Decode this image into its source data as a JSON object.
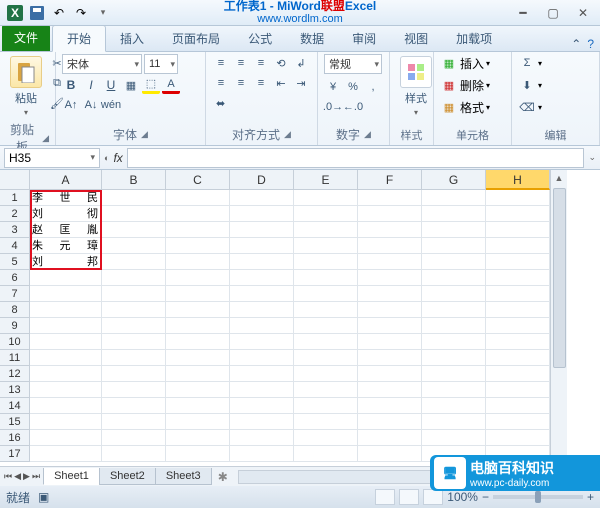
{
  "title": {
    "pre": "工作表1 - Mi",
    "brand_a": "Word",
    "brand_b": "联盟",
    "post": "Excel",
    "url": "www.wordlm.com"
  },
  "tabs": {
    "file": "文件",
    "home": "开始",
    "insert": "插入",
    "layout": "页面布局",
    "formulas": "公式",
    "data": "数据",
    "review": "审阅",
    "view": "视图",
    "addins": "加载项"
  },
  "ribbon": {
    "clipboard": {
      "label": "剪贴板",
      "paste": "粘贴"
    },
    "font": {
      "label": "字体",
      "name": "宋体",
      "size": "11"
    },
    "align": {
      "label": "对齐方式"
    },
    "number": {
      "label": "数字",
      "format": "常规"
    },
    "styles": {
      "label": "样式",
      "btn": "样式"
    },
    "cells": {
      "label": "单元格",
      "insert": "插入",
      "delete": "删除",
      "format": "格式"
    },
    "editing": {
      "label": "编辑"
    }
  },
  "namebox": "H35",
  "fx": "fx",
  "columns": [
    "A",
    "B",
    "C",
    "D",
    "E",
    "F",
    "G",
    "H"
  ],
  "rows_visible": 17,
  "data_colA": [
    "李世民",
    "刘彻",
    "赵匡胤",
    "朱元璋",
    "刘邦"
  ],
  "sheets": [
    "Sheet1",
    "Sheet2",
    "Sheet3"
  ],
  "status": {
    "ready": "就绪",
    "zoom": "100%"
  },
  "badge": {
    "title": "电脑百科知识",
    "sub": "www.pc-daily.com"
  }
}
